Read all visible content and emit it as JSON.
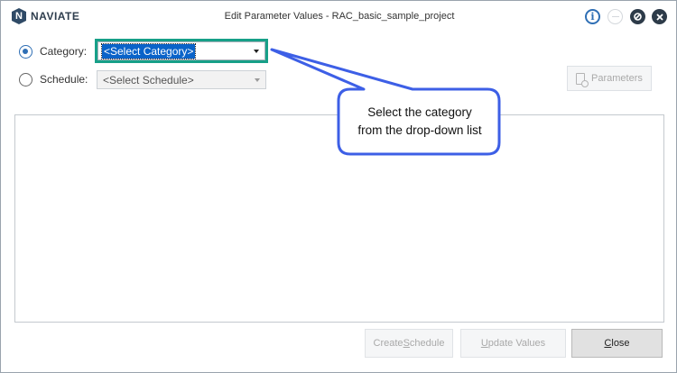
{
  "window": {
    "brand": "NAVIATE",
    "brand_badge": "N",
    "title": "Edit Parameter Values - RAC_basic_sample_project",
    "help_icon": "info-icon",
    "min_icon": "minimize-icon",
    "restore_icon": "restore-icon",
    "close_icon": "close-icon"
  },
  "form": {
    "category": {
      "label": "Category:",
      "selected": "<Select Category>",
      "checked": true
    },
    "schedule": {
      "label": "Schedule:",
      "selected": "<Select Schedule>",
      "checked": false
    },
    "parameters_button": "Parameters"
  },
  "callout": {
    "line1": "Select the category",
    "line2": "from the drop-down list",
    "color": "#3d5fe6"
  },
  "buttons": {
    "create_pre": "Create ",
    "create_ul": "S",
    "create_post": "chedule",
    "update_ul": "U",
    "update_post": "pdate Values",
    "close_ul": "C",
    "close_post": "lose"
  },
  "colors": {
    "accent": "#2f6fb5",
    "highlight": "#17a088",
    "selection": "#0a63c9"
  }
}
